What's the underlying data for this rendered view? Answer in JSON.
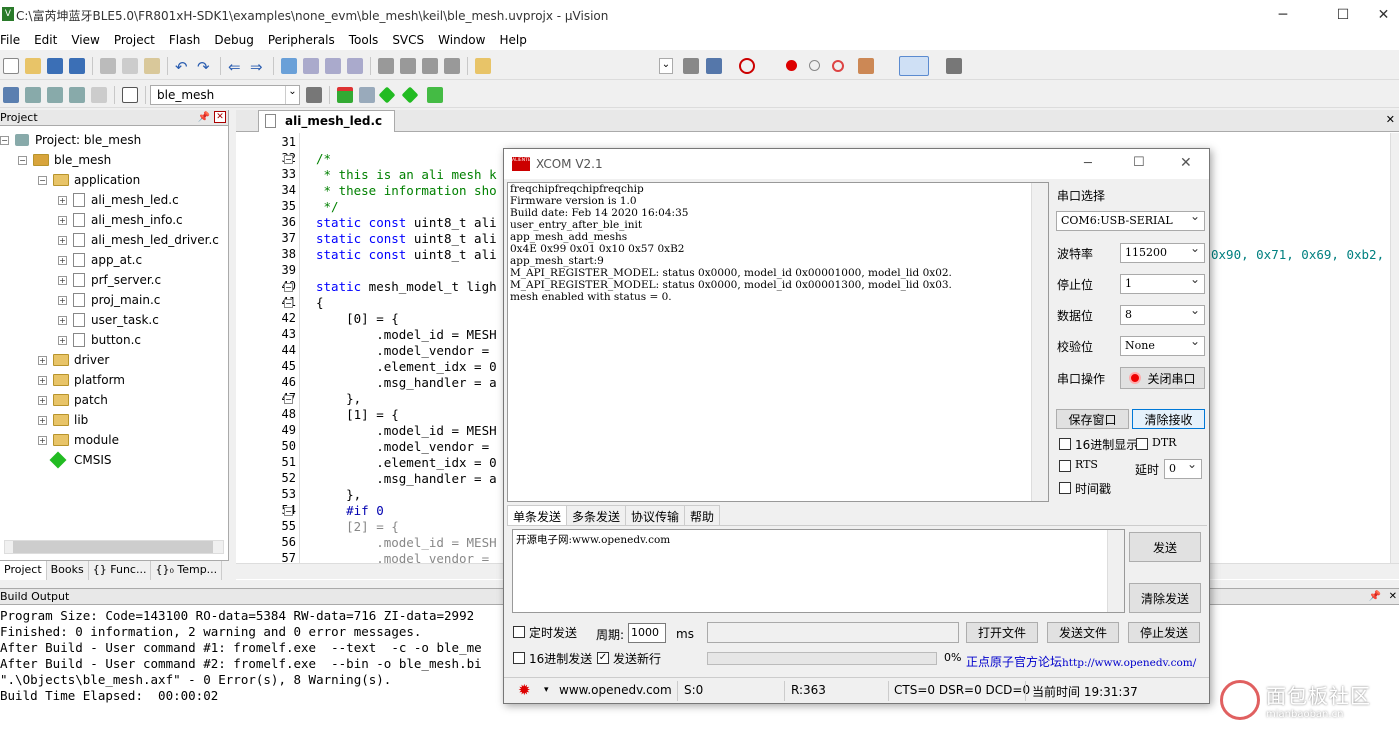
{
  "window": {
    "title": "C:\\富芮坤蓝牙BLE5.0\\FR801xH-SDK1\\examples\\none_evm\\ble_mesh\\keil\\ble_mesh.uvprojx - µVision"
  },
  "menu": [
    "File",
    "Edit",
    "View",
    "Project",
    "Flash",
    "Debug",
    "Peripherals",
    "Tools",
    "SVCS",
    "Window",
    "Help"
  ],
  "toolbar2": {
    "target": "ble_mesh"
  },
  "project_panel": {
    "title": "Project",
    "root": "Project: ble_mesh",
    "target": "ble_mesh",
    "group_open": "application",
    "files": [
      "ali_mesh_led.c",
      "ali_mesh_info.c",
      "ali_mesh_led_driver.c",
      "app_at.c",
      "prf_server.c",
      "proj_main.c",
      "user_task.c",
      "button.c"
    ],
    "groups": [
      "driver",
      "platform",
      "patch",
      "lib",
      "module"
    ],
    "cmsis": "CMSIS",
    "tabs": [
      "Project",
      "Books",
      "{} Func...",
      "{}₀ Temp..."
    ]
  },
  "editor": {
    "tab": "ali_mesh_led.c",
    "lines": [
      "31",
      "32",
      "33",
      "34",
      "35",
      "36",
      "37",
      "38",
      "39",
      "40",
      "41",
      "42",
      "43",
      "44",
      "45",
      "46",
      "47",
      "48",
      "49",
      "50",
      "51",
      "52",
      "53",
      "54",
      "55",
      "56",
      "57"
    ],
    "code": {
      "l32": "/*",
      "l33": " * this is an ali mesh k",
      "l34": " * these information sho",
      "l35": " */",
      "l36a": "static const",
      "l36b": " uint8_t ali",
      "l37a": "static const",
      "l37b": " uint8_t ali",
      "l38a": "static const",
      "l38b": " uint8_t ali",
      "l40a": "static",
      "l40b": " mesh_model_t ligh",
      "l41": "{",
      "l42": "    [0] = {",
      "l43": "        .model_id = MESH",
      "l44": "        .model_vendor = ",
      "l45": "        .element_idx = 0",
      "l46": "        .msg_handler = a",
      "l47": "    },",
      "l48": "    [1] = {",
      "l49": "        .model_id = MESH",
      "l50": "        .model_vendor = ",
      "l51": "        .element_idx = 0",
      "l52": "        .msg_handler = a",
      "l53": "    },",
      "l54": "    #if 0",
      "l55": "    [2] = {",
      "l56": "        .model_id = MESH",
      "l57": "        .model_vendor = ",
      "right": "0x90, 0x71, 0x69, 0xb2,"
    }
  },
  "build_output": {
    "title": "Build Output",
    "lines": [
      "Program Size: Code=143100 RO-data=5384 RW-data=716 ZI-data=2992",
      "Finished: 0 information, 2 warning and 0 error messages.",
      "After Build - User command #1: fromelf.exe  --text  -c -o ble_me",
      "After Build - User command #2: fromelf.exe  --bin -o ble_mesh.bi",
      "\".\\Objects\\ble_mesh.axf\" - 0 Error(s), 8 Warning(s).",
      "Build Time Elapsed:  00:00:02"
    ]
  },
  "xcom": {
    "title": "XCOM V2.1",
    "logo": "ALIENTEK",
    "receive": [
      "freqchipfreqchipfreqchip",
      "Firmware version is 1.0",
      "Build date: Feb 14 2020 16:04:35",
      "user_entry_after_ble_init",
      "app_mesh_add_meshs",
      "0x4E 0x99 0x01 0x10 0x57 0xB2",
      "app_mesh_start:9",
      "M_API_REGISTER_MODEL: status 0x0000, model_id 0x00001000, model_lid 0x02.",
      "M_API_REGISTER_MODEL: status 0x0000, model_id 0x00001300, model_lid 0x03.",
      "mesh enabled with status = 0."
    ],
    "port_select_label": "串口选择",
    "port_value": "COM6:USB-SERIAL",
    "baud_label": "波特率",
    "baud_value": "115200",
    "stop_label": "停止位",
    "stop_value": "1",
    "data_label": "数据位",
    "data_value": "8",
    "parity_label": "校验位",
    "parity_value": "None",
    "op_label": "串口操作",
    "close_port": "关闭串口",
    "save_window": "保存窗口",
    "clear_recv": "清除接收",
    "hex_display": "16进制显示",
    "dtr": "DTR",
    "rts": "RTS",
    "delay_label": "延时",
    "delay_value": "0",
    "timestamp": "时间戳",
    "tabs": [
      "单条发送",
      "多条发送",
      "协议传输",
      "帮助"
    ],
    "send_text": "开源电子网:www.openedv.com",
    "send_btn": "发送",
    "clear_send": "清除发送",
    "timed_send": "定时发送",
    "period_label": "周期:",
    "period_value": "1000",
    "period_unit": "ms",
    "open_file": "打开文件",
    "send_file": "发送文件",
    "stop_send": "停止发送",
    "hex_send": "16进制发送",
    "newline_send": "发送新行",
    "progress": "0%",
    "forum_label": "正点原子官方论坛",
    "forum_url": "http://www.openedv.com/",
    "status": {
      "site": "www.openedv.com",
      "s": "S:0",
      "r": "R:363",
      "lines": "CTS=0 DSR=0 DCD=0",
      "time": "当前时间 19:31:37"
    }
  },
  "watermark": {
    "text": "面包板社区",
    "sub": "mianbaoban.cn"
  }
}
